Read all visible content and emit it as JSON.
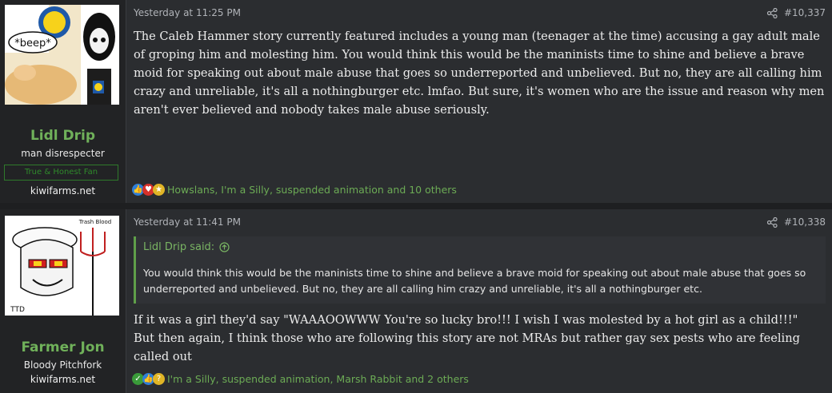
{
  "posts": [
    {
      "username": "Lidl Drip",
      "user_title": "man disrespecter",
      "badge": "True & Honest Fan",
      "site": "kiwifarms.net",
      "avatar_text": "*beep*",
      "date": "Yesterday at 11:25 PM",
      "post_number": "#10,337",
      "body": "The Caleb Hammer story currently featured includes a young man (teenager at the time) accusing a gay adult male of groping him and molesting him. You would think this would be the maninists time to shine and believe a brave moid for speaking out about male abuse that goes so underreported and unbelieved. But no, they are all calling him crazy and unreliable, it's all a nothingburger etc. lmfao. But sure, it's women who are the issue and reason why men aren't ever believed and nobody takes male abuse seriously.",
      "reaction_icons": [
        "like-icon",
        "heart-icon",
        "prize-icon"
      ],
      "reactions": "Howslans, I'm a Silly, suspended animation and 10 others"
    },
    {
      "username": "Farmer Jon",
      "user_title": "Bloody Pitchfork",
      "site": "kiwifarms.net",
      "avatar_text": "Trash Blood",
      "avatar_text2": "TTD",
      "date": "Yesterday at 11:41 PM",
      "post_number": "#10,338",
      "quote_author": "Lidl Drip said:",
      "quote_text": "You would think this would be the maninists time to shine and believe a brave moid for speaking out about male abuse that goes so underreported and unbelieved. But no, they are all calling him crazy and unreliable, it's all a nothingburger etc.",
      "body_line1": "If it was a girl they'd say \"WAAAOOWWW You're so lucky bro!!! I wish I was molested by a hot girl as a child!!!\"",
      "body_line2": "But then again, I think those who are following this story are not MRAs but rather gay sex pests who are feeling called out",
      "reaction_icons": [
        "agree-icon",
        "like-icon",
        "thinking-icon"
      ],
      "reactions": "I'm a Silly, suspended animation, Marsh Rabbit and 2 others"
    }
  ],
  "colors": {
    "accent": "#70b15a",
    "badge": "#2f8a2b"
  }
}
